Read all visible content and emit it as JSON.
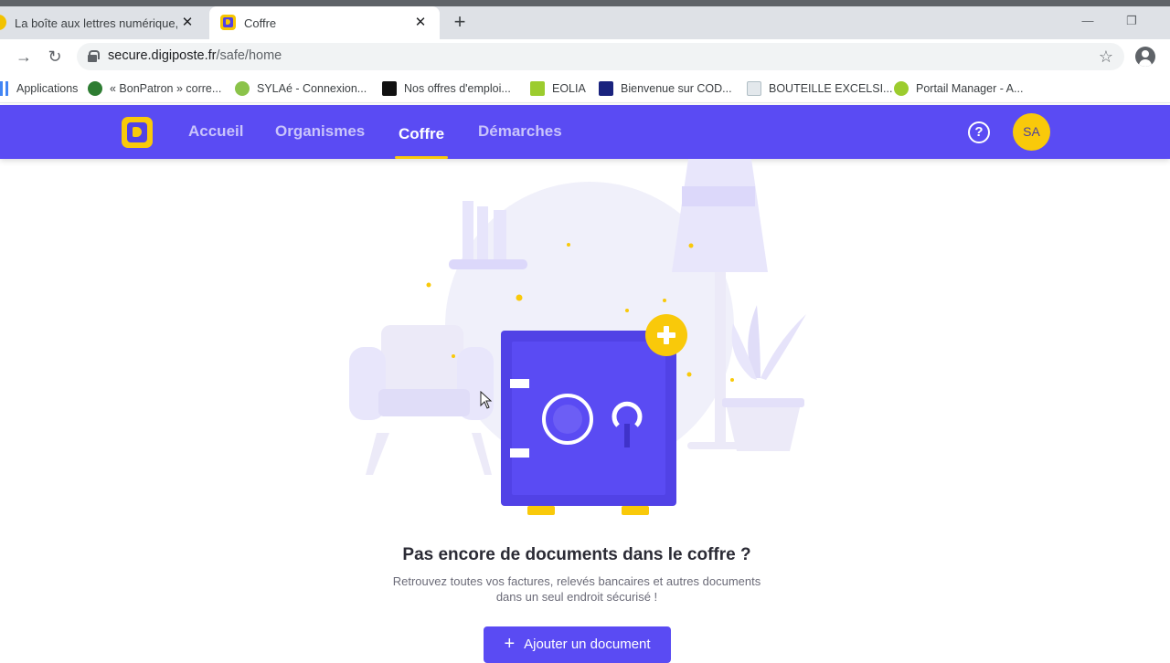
{
  "browser": {
    "tabs": [
      {
        "title": "La boîte aux lettres numérique, in",
        "active": false
      },
      {
        "title": "Coffre",
        "active": true
      }
    ],
    "new_tab_label": "+",
    "url": {
      "host": "secure.digiposte.fr",
      "path": "/safe/home"
    },
    "bookmarks": [
      {
        "label": "Applications",
        "icon": "apps-grid-icon",
        "color": "#4285f4"
      },
      {
        "label": "« BonPatron » corre...",
        "icon": "check-badge-icon",
        "color": "#2e7d32"
      },
      {
        "label": "SYLAé - Connexion...",
        "icon": "sylae-logo-icon",
        "color": "#8bc34a"
      },
      {
        "label": "Nos offres d'emploi...",
        "icon": "dark-square-logo-icon",
        "color": "#111111"
      },
      {
        "label": "EOLIA",
        "icon": "eolia-logo-icon",
        "color": "#9ccc2e"
      },
      {
        "label": "Bienvenue sur COD...",
        "icon": "navy-flag-icon",
        "color": "#1a237e"
      },
      {
        "label": "BOUTEILLE EXCELSI...",
        "icon": "document-page-icon",
        "color": "#b0bec5"
      },
      {
        "label": "Portail Manager - A...",
        "icon": "runner-icon",
        "color": "#9ccc2e"
      }
    ]
  },
  "site": {
    "nav": [
      {
        "label": "Accueil",
        "active": false
      },
      {
        "label": "Organismes",
        "active": false
      },
      {
        "label": "Coffre",
        "active": true
      },
      {
        "label": "Démarches",
        "active": false
      }
    ],
    "help_label": "?",
    "user_initials": "SA",
    "colors": {
      "primary": "#5a4bf3",
      "accent": "#f9c90a"
    }
  },
  "main": {
    "empty_title": "Pas encore de documents dans le coffre ?",
    "empty_desc_line1": "Retrouvez toutes vos factures, relevés bancaires et autres documents",
    "empty_desc_line2": "dans un seul endroit sécurisé !",
    "add_button_icon": "+",
    "add_button_label": "Ajouter un document"
  }
}
